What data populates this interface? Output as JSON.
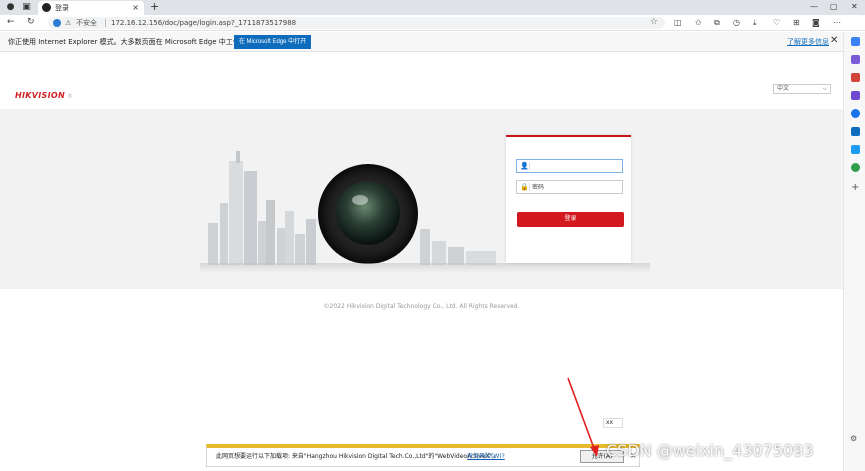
{
  "browser": {
    "tab_title": "登录",
    "tab_close": "×",
    "new_tab": "+",
    "window_minimize": "—",
    "window_maximize": "▢",
    "window_close": "✕",
    "not_secure": "不安全",
    "url": "172.16.12.156/doc/page/login.asp?_1711873517988"
  },
  "ie_infobar": {
    "message": "你正使用 Internet Explorer 模式。大多数页面在 Microsoft Edge 中工作效果更佳。",
    "open_button": "在 Microsoft Edge 中打开",
    "learn_more": "了解更多信息",
    "close": "✕"
  },
  "page": {
    "logo": "HIKVISION",
    "logo_mark": "®",
    "language": "中文",
    "login": {
      "username_value": "",
      "password_placeholder": "密码",
      "login_button": "登录"
    },
    "copyright": "©2022 Hikvision Digital Technology Co., Ltd. All Rights Reserved."
  },
  "ime_indicator": "xx",
  "activex_bar": {
    "message": "此网页想要运行以下加载项: 来自\"Hangzhou Hikvision Digital Tech.Co.,Ltd\"的\"WebVideoActiveX\"。",
    "risk_link": "有何风险(W)?",
    "allow_button": "允许(A)",
    "close": "×"
  },
  "watermark": "CSDN @weixin_43075093",
  "colors": {
    "brand_red": "#d3191f",
    "edge_blue": "#0f6cbd",
    "activex_yellow": "#e8ba2f"
  }
}
